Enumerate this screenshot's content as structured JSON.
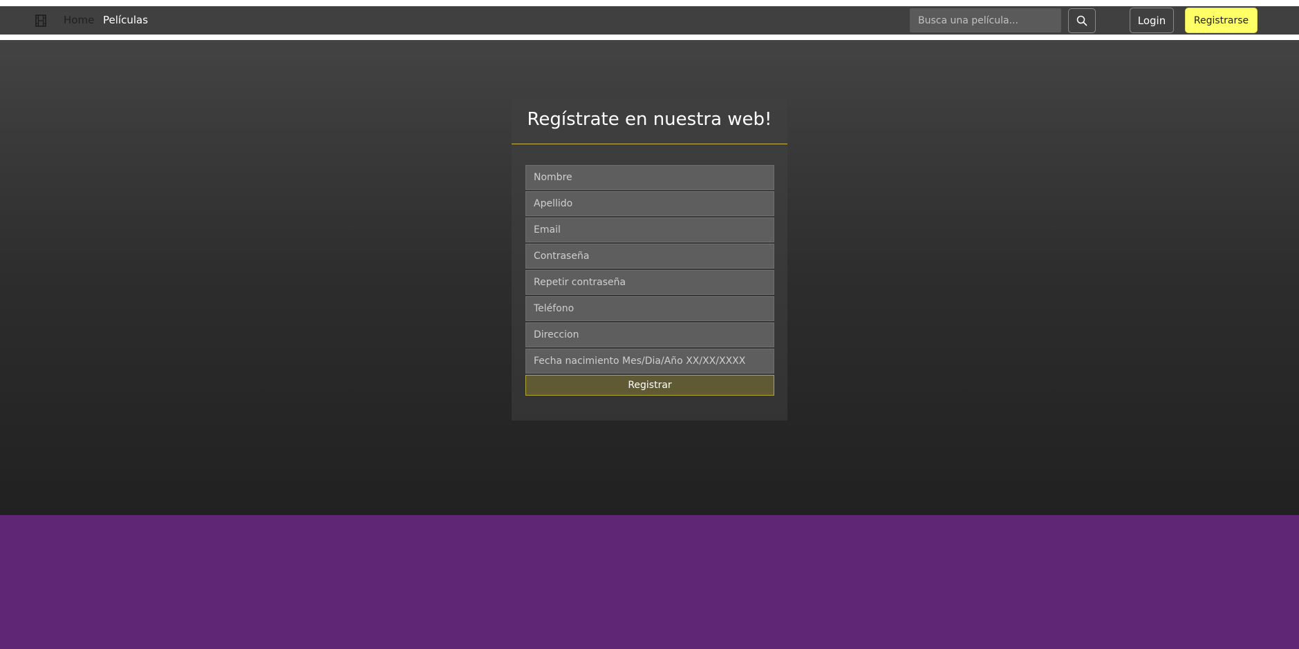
{
  "navbar": {
    "brand_icon": "film-icon",
    "links": {
      "home": "Home",
      "movies": "Películas"
    },
    "search": {
      "placeholder": "Busca una película...",
      "value": "",
      "icon": "search-icon"
    },
    "login_label": "Login",
    "register_label": "Registrarse"
  },
  "form": {
    "title": "Regístrate en nuestra web!",
    "fields": {
      "nombre": {
        "placeholder": "Nombre",
        "value": ""
      },
      "apellido": {
        "placeholder": "Apellido",
        "value": ""
      },
      "email": {
        "placeholder": "Email",
        "value": ""
      },
      "password": {
        "placeholder": "Contraseña",
        "value": ""
      },
      "password_repeat": {
        "placeholder": "Repetir contraseña",
        "value": ""
      },
      "telefono": {
        "placeholder": "Teléfono",
        "value": ""
      },
      "direccion": {
        "placeholder": "Direccion",
        "value": ""
      },
      "fecha": {
        "placeholder": "Fecha nacimiento Mes/Dia/Año XX/XX/XXXX",
        "value": ""
      }
    },
    "submit_label": "Registrar"
  },
  "colors": {
    "navbar_bg": "#404040",
    "accent_yellow": "#ffff66",
    "divider_gold": "#cdb84a",
    "footer_purple": "#5f2675"
  }
}
